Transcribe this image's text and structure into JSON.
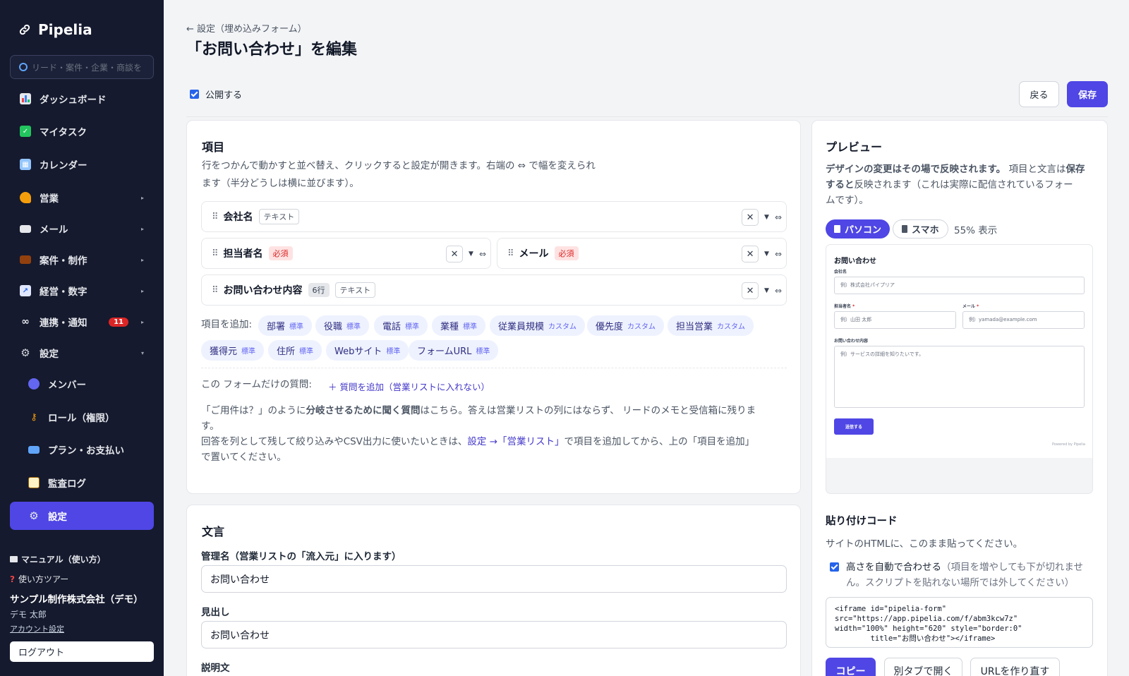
{
  "app": {
    "name": "Pipelia"
  },
  "search": {
    "placeholder": "リード・案件・企業・商談を"
  },
  "sidebar": {
    "items": [
      {
        "label": "ダッシュボード"
      },
      {
        "label": "マイタスク"
      },
      {
        "label": "カレンダー"
      },
      {
        "label": "営業"
      },
      {
        "label": "メール"
      },
      {
        "label": "案件・制作"
      },
      {
        "label": "経営・数字"
      },
      {
        "label": "連携・通知",
        "badge": "11"
      },
      {
        "label": "設定"
      }
    ],
    "sub_items": [
      {
        "label": "メンバー"
      },
      {
        "label": "ロール（権限）"
      },
      {
        "label": "プラン・お支払い"
      },
      {
        "label": "監査ログ"
      },
      {
        "label": "設定"
      }
    ],
    "manual": "マニュアル（使い方）",
    "tour": "使い方ツアー",
    "org": "サンプル制作株式会社（デモ）",
    "user": "デモ 太郎",
    "account": "アカウント設定",
    "logout": "ログアウト"
  },
  "header": {
    "breadcrumb": "← 設定（埋め込みフォーム）",
    "title": "「お問い合わせ」を編集",
    "publish_label": "公開する",
    "publish_checked": true,
    "back": "戻る",
    "save": "保存"
  },
  "fields_card": {
    "title": "項目",
    "description": "行をつかんで動かすと並べ替え、クリックすると設定が開きます。右端の ⇔ で幅を変えられ",
    "description2": "ます（半分どうしは横に並びます）。",
    "fields": [
      {
        "name": "会社名",
        "tag": "テキスト"
      },
      {
        "name": "担当者名",
        "required": "必須"
      },
      {
        "name": "メール",
        "required": "必須"
      },
      {
        "name": "お問い合わせ内容",
        "rows": "6行",
        "tag": "テキスト"
      }
    ],
    "add_label": "項目を追加:",
    "chips": [
      {
        "name": "部署",
        "kind": "標準"
      },
      {
        "name": "役職",
        "kind": "標準"
      },
      {
        "name": "電話",
        "kind": "標準"
      },
      {
        "name": "業種",
        "kind": "標準"
      },
      {
        "name": "従業員規模",
        "kind": "カスタム"
      },
      {
        "name": "優先度",
        "kind": "カスタム"
      },
      {
        "name": "担当営業",
        "kind": "カスタム"
      },
      {
        "name": "獲得元",
        "kind": "標準"
      },
      {
        "name": "住所",
        "kind": "標準"
      },
      {
        "name": "Webサイト",
        "kind": "標準"
      },
      {
        "name": "フォームURL",
        "kind": "標準"
      }
    ],
    "own_q_label": "この フォームだけの質問:",
    "own_q_link": "＋ 質問を追加（営業リストに入れない）",
    "note1a": "「ご用件は？」のように",
    "note1b": "分岐させるために聞く質問",
    "note1c": "はこちら。答えは営業リストの列にはならず、 リードのメモと受信箱に残りま",
    "note1d": "す。",
    "note2a": "回答を列として残して絞り込みやCSV出力に使いたいときは、",
    "note2link": "設定 →「営業リスト」",
    "note2b": "で項目を追加してから、上の「項目を追加」",
    "note2c": "で置いてください。"
  },
  "text_card": {
    "title": "文言",
    "admin_label": "管理名（営業リストの「流入元」に入ります）",
    "admin_value": "お問い合わせ",
    "heading_label": "見出し",
    "heading_value": "お問い合わせ",
    "desc_label": "説明文"
  },
  "preview": {
    "title": "プレビュー",
    "note_b1": "デザインの変更はその場で反映されます。",
    "note_1": " 項目と文言は",
    "note_b2": "保存すると",
    "note_2": "反映されます（これは実際に配信されているフォー",
    "note_3": "ムです）。",
    "pc": "パソコン",
    "sp": "スマホ",
    "zoom": "55% 表示",
    "form": {
      "title": "お問い合わせ",
      "company_label": "会社名",
      "company_ph": "例）株式会社パイプリア",
      "person_label": "担当者名",
      "person_ph": "例）山田 太郎",
      "mail_label": "メール",
      "mail_ph": "例）yamada@example.com",
      "req_mark": "*",
      "inquiry_label": "お問い合わせ内容",
      "inquiry_ph": "例）サービスの詳細を知りたいです。",
      "submit": "送信する",
      "powered": "Powered by Pipelia"
    }
  },
  "embed": {
    "title": "貼り付けコード",
    "desc": "サイトのHTMLに、このまま貼ってください。",
    "auto_label": "高さを自動で合わせる",
    "auto_note": "（項目を増やしても下が切れませ",
    "auto_note2": "ん。スクリプトを貼れない場所では外してください）",
    "code": "<iframe id=\"pipelia-form\"\nsrc=\"https://app.pipelia.com/f/abm3kcw7z\"\nwidth=\"100%\" height=\"620\" style=\"border:0\"\n        title=\"お問い合わせ\"></iframe>",
    "copy": "コピー",
    "open_tab": "別タブで開く",
    "regen": "URLを作り直す"
  },
  "colors": {
    "accent": "#4f46e5",
    "sidebar": "#151a2e",
    "danger": "#dc2626"
  }
}
